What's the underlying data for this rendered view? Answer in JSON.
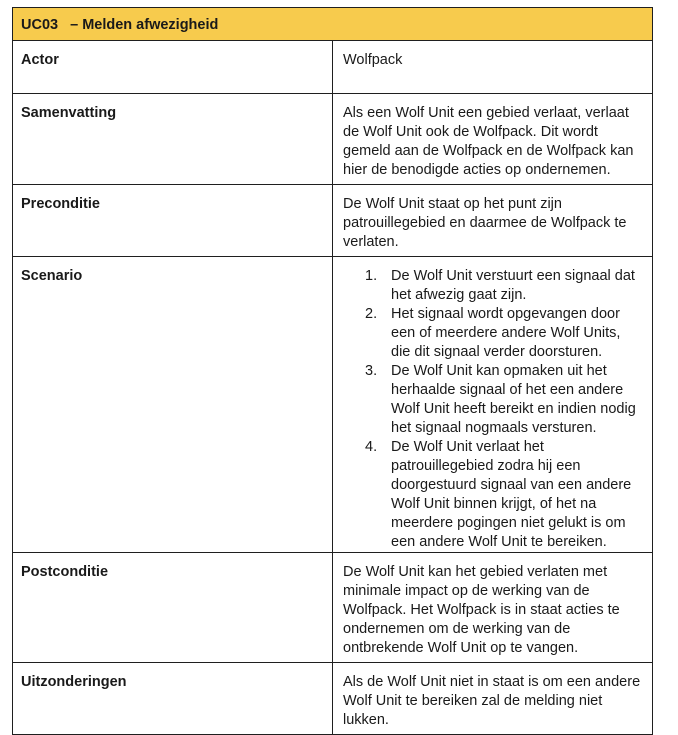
{
  "usecase": {
    "code": "UC03",
    "title": "– Melden afwezigheid"
  },
  "rows": {
    "actor": {
      "label": "Actor",
      "value": "Wolfpack"
    },
    "summary": {
      "label": "Samenvatting",
      "value": "Als een Wolf Unit een gebied verlaat, verlaat de Wolf Unit ook de Wolfpack. Dit wordt gemeld aan de Wolfpack en de Wolfpack kan hier de benodigde acties op ondernemen."
    },
    "precondition": {
      "label": "Preconditie",
      "value": "De Wolf Unit staat op het punt zijn patrouillegebied en daarmee de Wolfpack te verlaten."
    },
    "scenario": {
      "label": "Scenario",
      "steps": [
        {
          "num": "1.",
          "text": "De Wolf Unit verstuurt  een signaal dat het afwezig gaat zijn."
        },
        {
          "num": "2.",
          "text": "Het signaal wordt opgevangen door een of meerdere andere Wolf Units, die dit signaal verder doorsturen."
        },
        {
          "num": "3.",
          "text": "De Wolf Unit kan opmaken uit het herhaalde signaal of het een andere Wolf Unit heeft bereikt en indien nodig het signaal nogmaals versturen."
        },
        {
          "num": "4.",
          "text": "De Wolf Unit verlaat het patrouillegebied zodra hij een doorgestuurd signaal van een andere Wolf Unit binnen krijgt, of het na meerdere pogingen niet gelukt is om een andere Wolf Unit te bereiken."
        }
      ]
    },
    "postcondition": {
      "label": "Postconditie",
      "value": "De Wolf Unit kan het gebied verlaten met minimale impact op de werking van de Wolfpack. Het Wolfpack is in staat acties te ondernemen om de werking van de ontbrekende Wolf Unit op te vangen."
    },
    "exceptions": {
      "label": "Uitzonderingen",
      "value": "Als de Wolf Unit niet in staat is om een andere Wolf Unit te bereiken zal de melding niet lukken."
    }
  },
  "colors": {
    "header_background": "#f7cb4d",
    "border": "#1f1f1f"
  }
}
